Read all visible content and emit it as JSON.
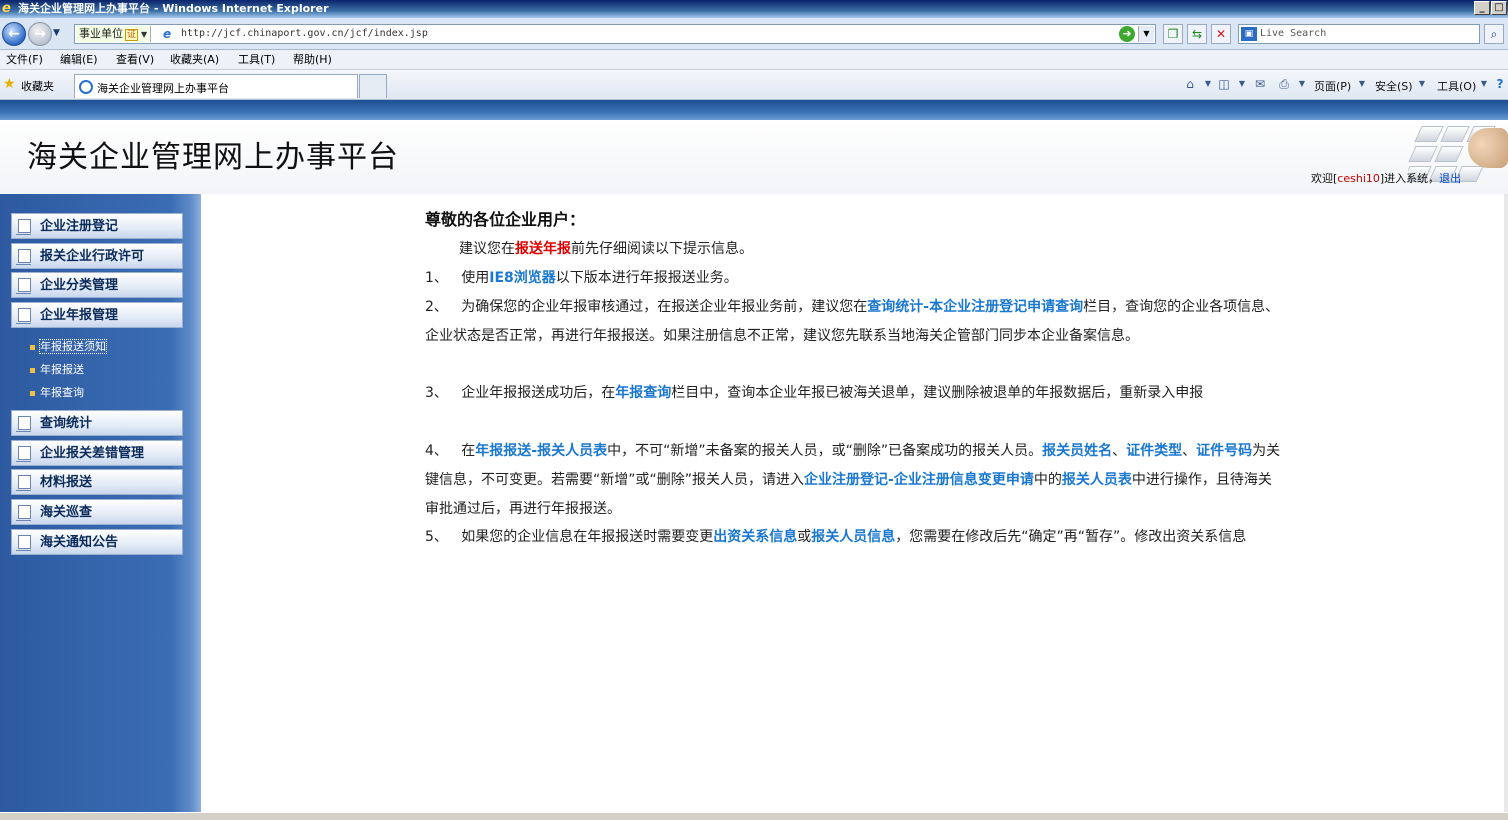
{
  "window": {
    "title": "海关企业管理网上办事平台 - Windows Internet Explorer",
    "minimize_label": "_",
    "ie_logo": "e"
  },
  "addressbar": {
    "category": "事业单位",
    "category_badge": "证",
    "url": "http://jcf.chinaport.gov.cn/jcf/index.jsp",
    "search_placeholder": "Live Search"
  },
  "menubar": {
    "items": [
      "文件(F)",
      "编辑(E)",
      "查看(V)",
      "收藏夹(A)",
      "工具(T)",
      "帮助(H)"
    ]
  },
  "favbar": {
    "favorites_label": "收藏夹",
    "tab_title": "海关企业管理网上办事平台",
    "commands": {
      "page": "页面(P)",
      "safety": "安全(S)",
      "tools": "工具(O)"
    }
  },
  "header": {
    "site_title": "海关企业管理网上办事平台",
    "welcome_prefix": "欢迎[",
    "username": "ceshi10",
    "welcome_suffix": "]进入系统，",
    "logout": "退出"
  },
  "sidebar": {
    "items_top": [
      {
        "label": "企业注册登记"
      },
      {
        "label": "报关企业行政许可"
      },
      {
        "label": "企业分类管理"
      },
      {
        "label": "企业年报管理"
      }
    ],
    "subitems": [
      {
        "label": "年报报送须知"
      },
      {
        "label": "年报报送"
      },
      {
        "label": "年报查询"
      }
    ],
    "items_bottom": [
      {
        "label": "查询统计"
      },
      {
        "label": "企业报关差错管理"
      },
      {
        "label": "材料报送"
      },
      {
        "label": "海关巡查"
      },
      {
        "label": "海关通知公告"
      }
    ]
  },
  "content": {
    "greeting": "尊敬的各位企业用户：",
    "intro": {
      "pre": "建议您在",
      "highlight": "报送年报",
      "post": "前先仔细阅读以下提示信息。"
    },
    "item1": {
      "num": "1、",
      "pre": "使用",
      "highlight": "IE8浏览器",
      "post": "以下版本进行年报报送业务。"
    },
    "item2": {
      "num": "2、",
      "pre": "为确保您的企业年报审核通过，在报送企业年报业务前，建议您在",
      "highlight": "查询统计-本企业注册登记申请查询",
      "post": "栏目，查询您的企业各项信息、企业状态是否正常，再进行年报报送。如果注册信息不正常，建议您先联系当地海关企管部门同步本企业备案信息。"
    },
    "item3": {
      "num": "3、",
      "pre": "企业年报报送成功后，在",
      "highlight": "年报查询",
      "post": "栏目中，查询本企业年报已被海关退单，建议删除被退单的年报数据后，重新录入申报"
    },
    "item4": {
      "num": "4、",
      "t1": "在",
      "h1": "年报报送-报关人员表",
      "t2": "中，不可“新增”未备案的报关人员，或“删除”已备案成功的报关人员。",
      "h2": "报关员姓名",
      "t3": "、",
      "h3": "证件类型",
      "t4": "、",
      "h4": "证件号码",
      "t5": "为关键信息，不可变更。若需要“新增”或“删除”报关人员，请进入",
      "h5": "企业注册登记-企业注册信息变更申请",
      "t6": "中的",
      "h6": "报关人员表",
      "t7": "中进行操作，且待海关审批通过后，再进行年报报送。"
    },
    "item5": {
      "num": "5、",
      "t1": "如果您的企业信息在年报报送时需要变更",
      "h1": "出资关系信息",
      "t2": "或",
      "h2": "报关人员信息",
      "t3": "，您需要在修改后先“确定”再“暂存”。修改出资关系信息"
    }
  }
}
